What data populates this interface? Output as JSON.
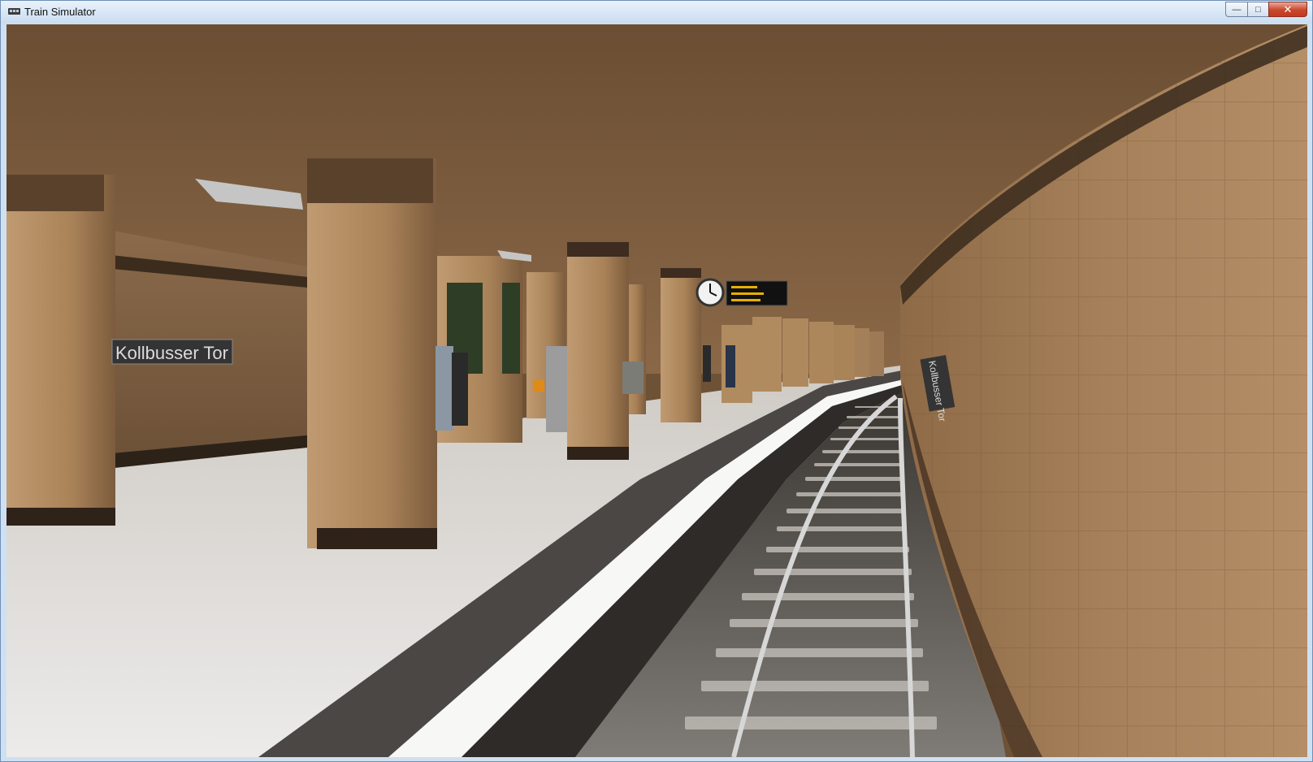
{
  "window": {
    "title": "Train Simulator",
    "controls": {
      "minimize": "minimize-icon",
      "maximize": "maximize-icon",
      "close": "close-icon"
    }
  },
  "scene": {
    "station_sign_left": "Kollbusser Tor",
    "station_sign_right": "Kollbusser Tor"
  },
  "colors": {
    "ceiling": "#7a5a3b",
    "pillar": "#b08760",
    "platform": "#e6e4e1",
    "wall_right": "#9a7650",
    "close_button": "#c7432a"
  }
}
